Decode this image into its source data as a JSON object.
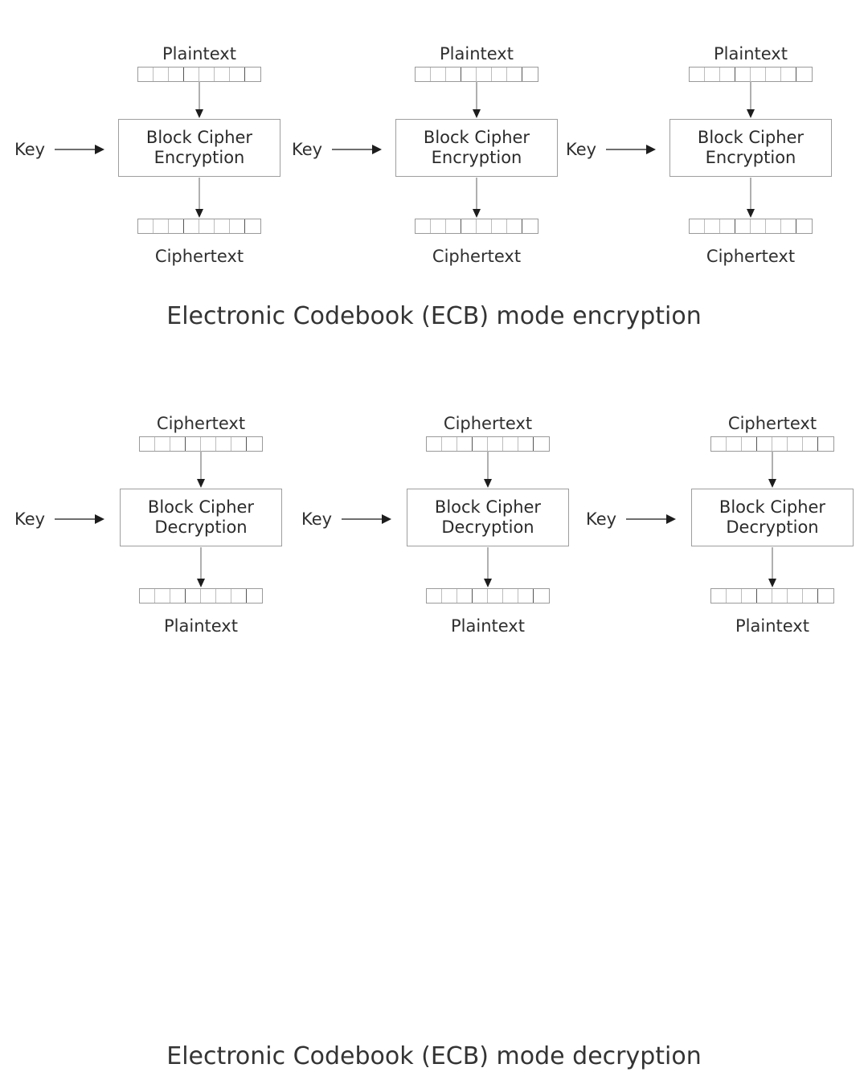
{
  "diagram": {
    "title": "Electronic Codebook (ECB) mode",
    "sections": [
      {
        "id": "encryption",
        "caption": "Electronic Codebook (ECB) mode encryption",
        "input_label": "Plaintext",
        "output_label": "Ciphertext",
        "key_label": "Key",
        "cipher_line_1": "Block Cipher",
        "cipher_line_2": "Encryption",
        "columns": [
          {
            "index": 1,
            "input_label": "Plaintext",
            "output_label": "Ciphertext",
            "key_label": "Key",
            "cipher_line_1": "Block Cipher",
            "cipher_line_2": "Encryption",
            "input_cells": 8,
            "output_cells": 8
          },
          {
            "index": 2,
            "input_label": "Plaintext",
            "output_label": "Ciphertext",
            "key_label": "Key",
            "cipher_line_1": "Block Cipher",
            "cipher_line_2": "Encryption",
            "input_cells": 8,
            "output_cells": 8
          },
          {
            "index": 3,
            "input_label": "Plaintext",
            "output_label": "Ciphertext",
            "key_label": "Key",
            "cipher_line_1": "Block Cipher",
            "cipher_line_2": "Encryption",
            "input_cells": 8,
            "output_cells": 8
          }
        ]
      },
      {
        "id": "decryption",
        "caption": "Electronic Codebook (ECB) mode decryption",
        "input_label": "Ciphertext",
        "output_label": "Plaintext",
        "key_label": "Key",
        "cipher_line_1": "Block Cipher",
        "cipher_line_2": "Decryption",
        "columns": [
          {
            "index": 1,
            "input_label": "Ciphertext",
            "output_label": "Plaintext",
            "key_label": "Key",
            "cipher_line_1": "Block Cipher",
            "cipher_line_2": "Decryption",
            "input_cells": 8,
            "output_cells": 8
          },
          {
            "index": 2,
            "input_label": "Ciphertext",
            "output_label": "Plaintext",
            "key_label": "Key",
            "cipher_line_1": "Block Cipher",
            "cipher_line_2": "Decryption",
            "input_cells": 8,
            "output_cells": 8
          },
          {
            "index": 3,
            "input_label": "Ciphertext",
            "output_label": "Plaintext",
            "key_label": "Key",
            "cipher_line_1": "Block Cipher",
            "cipher_line_2": "Decryption",
            "input_cells": 8,
            "output_cells": 8
          }
        ]
      }
    ],
    "colors": {
      "background": "#ffffff",
      "text": "#2b2b2b",
      "box_border": "#9e9e9e",
      "cell_border": "#bdbdbd",
      "cell_border_heavy": "#555555",
      "arrow_shaft": "#b0b0b0",
      "arrow_head": "#1d1d1d",
      "caption_text": "#343434"
    }
  }
}
